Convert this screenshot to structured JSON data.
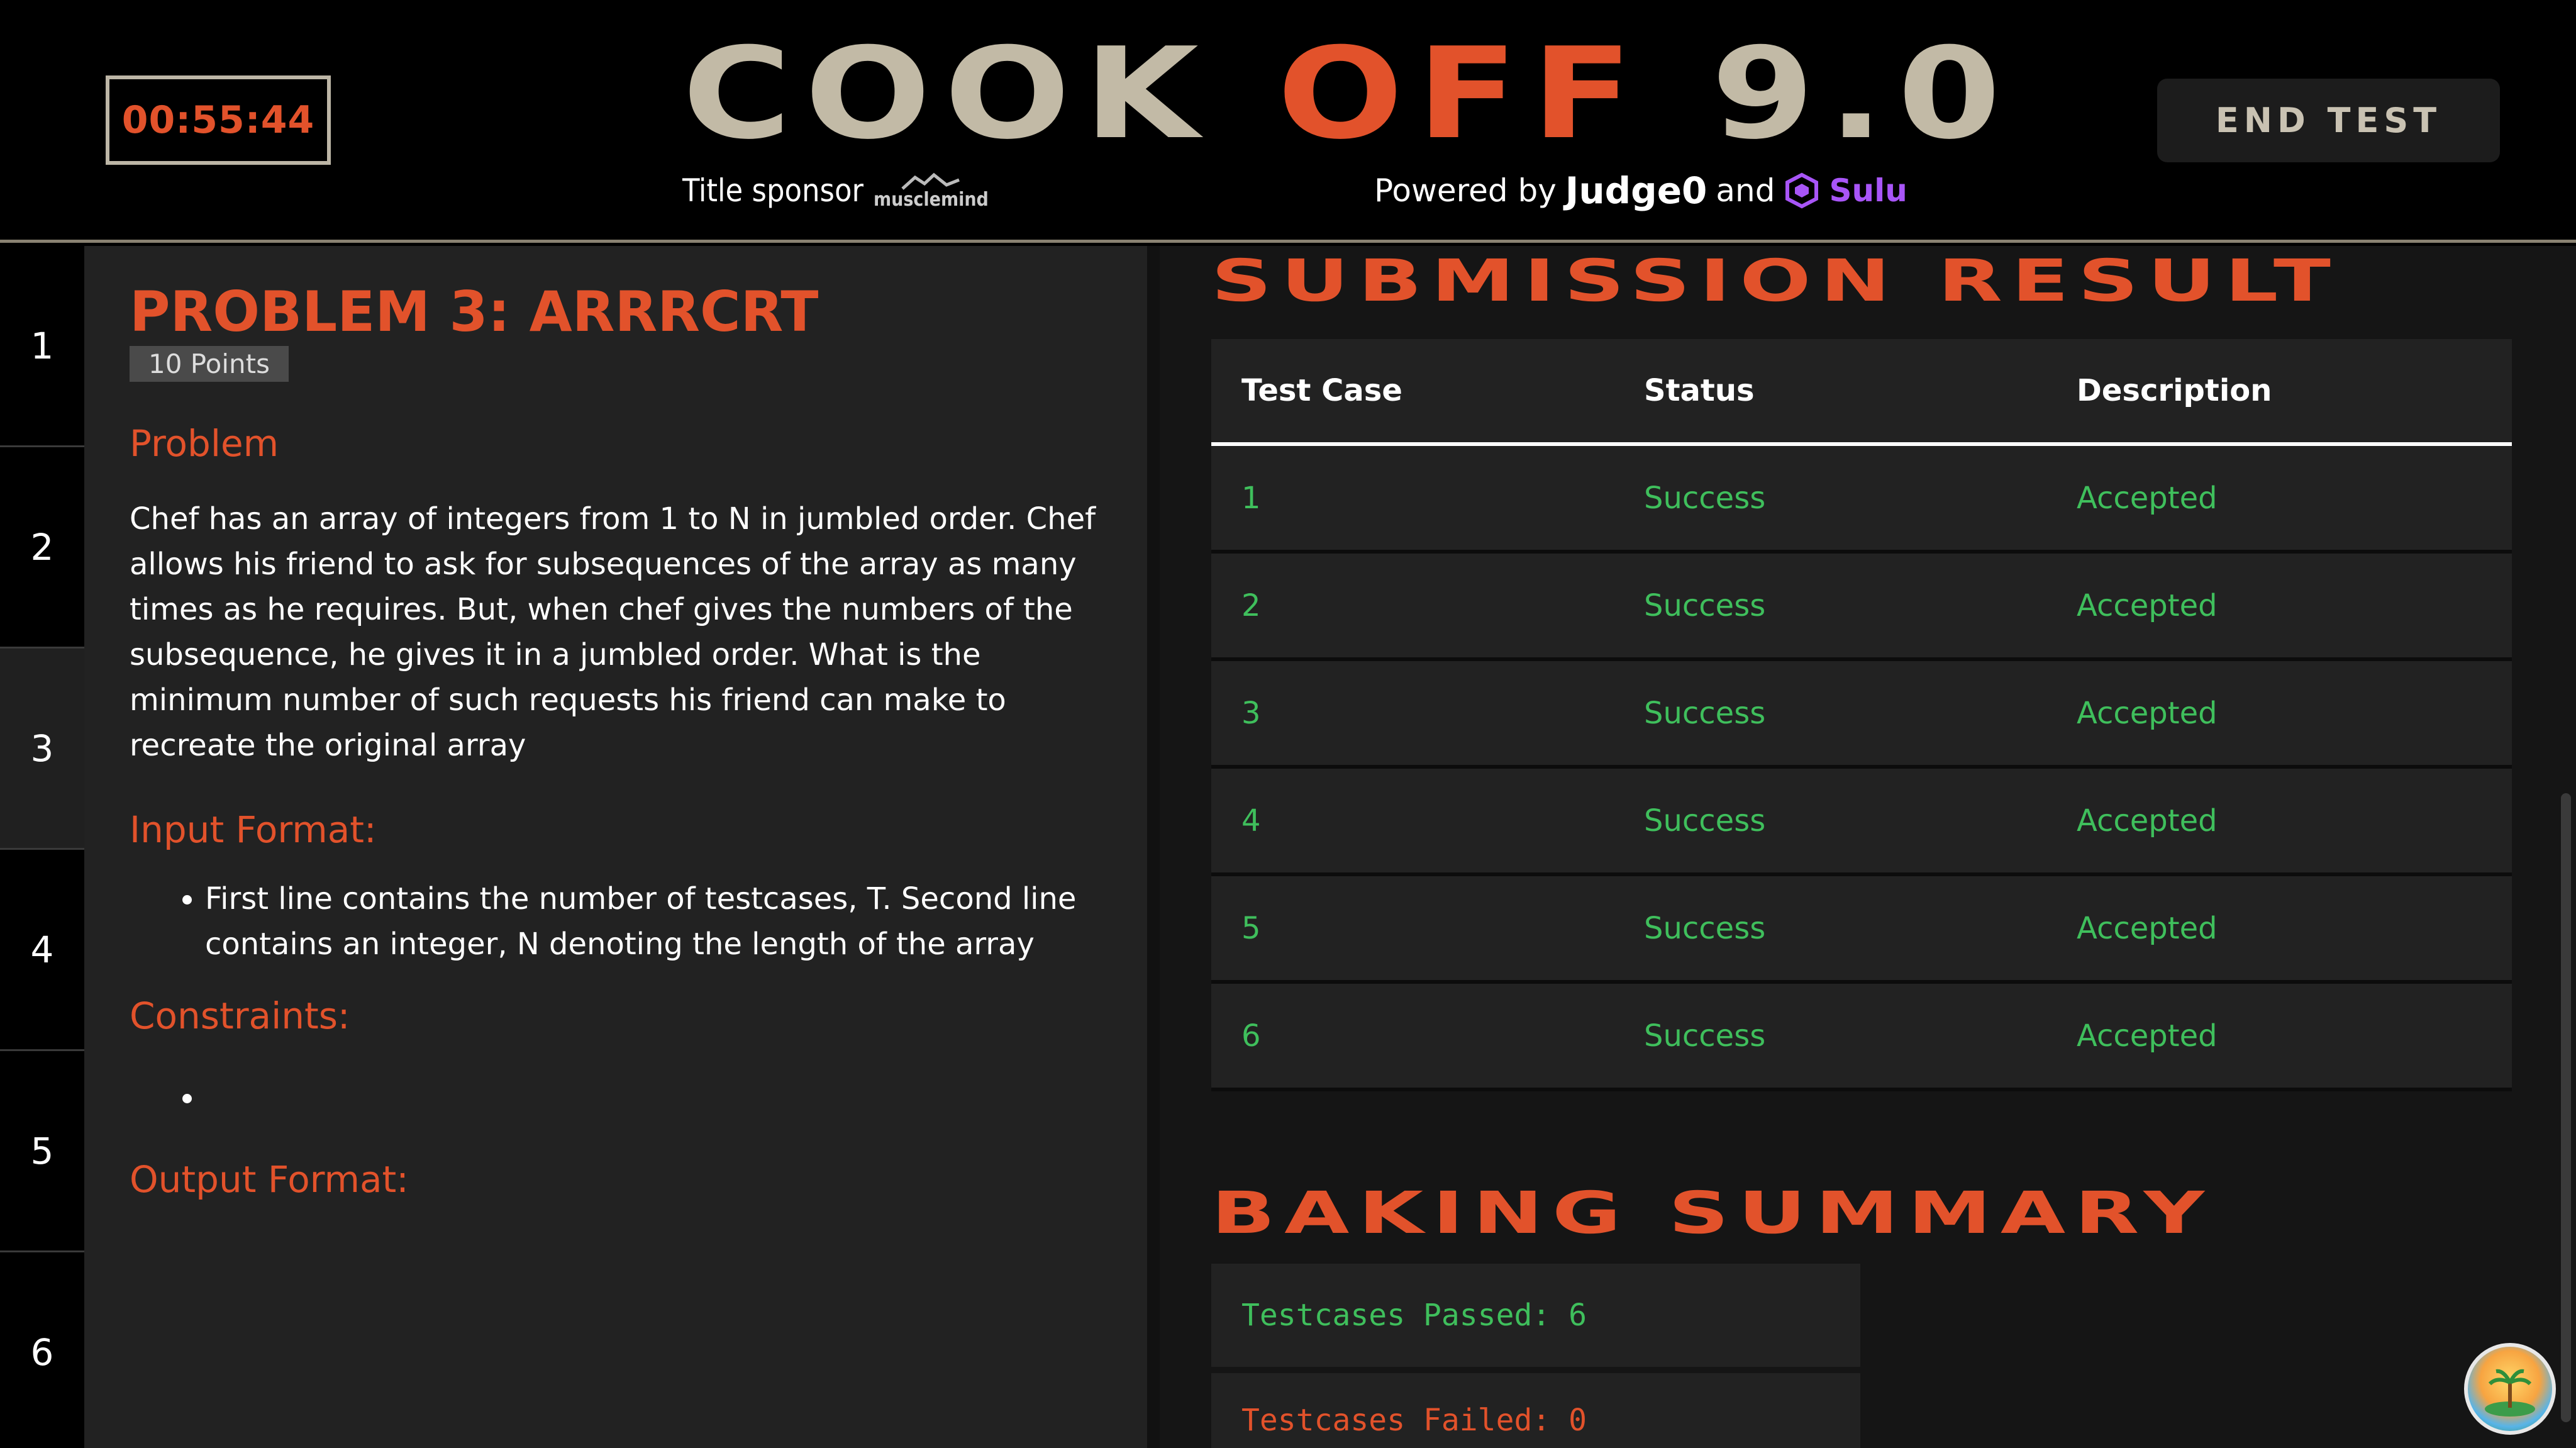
{
  "header": {
    "timer": "00:55:44",
    "title_part1": "COOK",
    "title_part2": "OFF",
    "title_part3": "9.0",
    "sponsor_label": "Title sponsor",
    "sponsor_name": "musclemind",
    "powered_label": "Powered by",
    "judge_name": "Judge0",
    "and_label": "and",
    "sulu_name": "Sulu",
    "end_button": "END TEST"
  },
  "sidebar": {
    "items": [
      "1",
      "2",
      "3",
      "4",
      "5",
      "6"
    ],
    "active": "3"
  },
  "problem": {
    "title": "PROBLEM 3: ARRRCRT",
    "points": "10 Points",
    "problem_heading": "Problem",
    "problem_text": "Chef has an array of integers from 1 to N in jumbled order. Chef allows his friend to ask for subsequences of the array as many times as he requires. But, when chef gives the numbers of the subsequence, he gives it in a jumbled order. What is the minimum number of such requests his friend can make to recreate the original array",
    "input_heading": "Input Format:",
    "input_bullets": [
      "First line contains the number of testcases, T. Second line contains an integer, N denoting the length of the array"
    ],
    "constraints_heading": "Constraints:",
    "output_heading": "Output Format:"
  },
  "result": {
    "title": "SUBMISSION RESULT",
    "columns": [
      "Test Case",
      "Status",
      "Description"
    ],
    "rows": [
      [
        "1",
        "Success",
        "Accepted"
      ],
      [
        "2",
        "Success",
        "Accepted"
      ],
      [
        "3",
        "Success",
        "Accepted"
      ],
      [
        "4",
        "Success",
        "Accepted"
      ],
      [
        "5",
        "Success",
        "Accepted"
      ],
      [
        "6",
        "Success",
        "Accepted"
      ]
    ]
  },
  "summary": {
    "title": "BAKING SUMMARY",
    "passed": "Testcases Passed: 6",
    "failed": "Testcases Failed: 0"
  },
  "colors": {
    "accent": "#e2522b",
    "success": "#3fbf5c",
    "title_beige": "#c2baa6",
    "sulu_purple": "#a855f7"
  }
}
